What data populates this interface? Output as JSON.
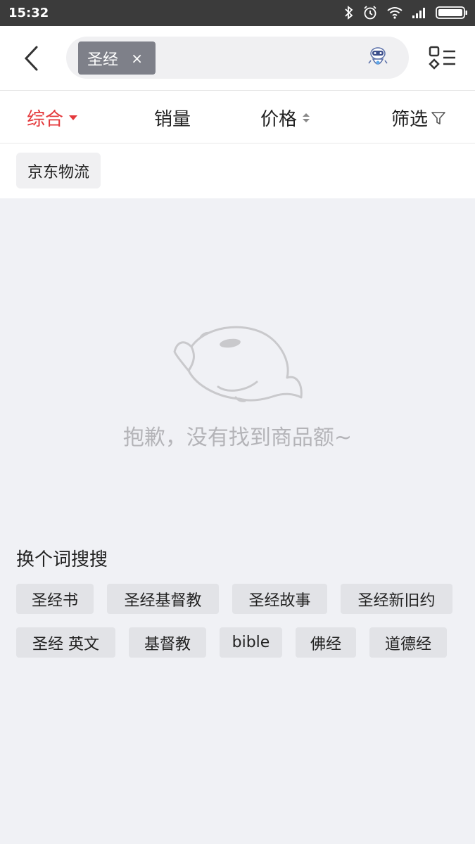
{
  "status_bar": {
    "time": "15:32"
  },
  "search": {
    "keyword_tag": "圣经",
    "clear_symbol": "×"
  },
  "sort_bar": {
    "items": [
      {
        "label": "综合",
        "active": true
      },
      {
        "label": "销量",
        "active": false
      },
      {
        "label": "价格",
        "active": false
      },
      {
        "label": "筛选",
        "active": false
      }
    ]
  },
  "filters": {
    "jd_logistics": "京东物流"
  },
  "empty_state": {
    "message": "抱歉，没有找到商品额~"
  },
  "suggestions": {
    "title": "换个词搜搜",
    "items": [
      "圣经书",
      "圣经基督教",
      "圣经故事",
      "圣经新旧约",
      "圣经 英文",
      "基督教",
      "bible",
      "佛经",
      "道德经"
    ]
  },
  "colors": {
    "accent": "#e4393c",
    "page_bg": "#f0f1f5",
    "status_bar": "#3b3b3b"
  }
}
